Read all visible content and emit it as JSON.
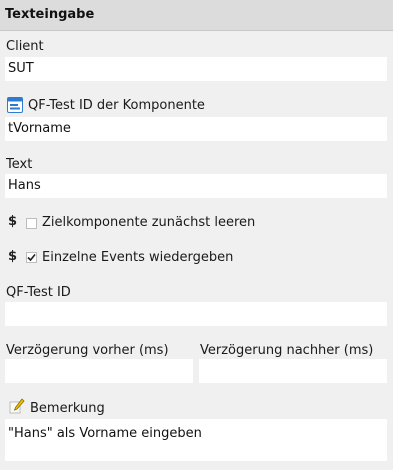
{
  "header": {
    "title": "Texteingabe"
  },
  "client": {
    "label": "Client",
    "value": "SUT"
  },
  "component_id": {
    "label": "QF-Test ID der Komponente",
    "value": "tVorname",
    "icon": "component-window-icon"
  },
  "text": {
    "label": "Text",
    "value": "Hans"
  },
  "clear_target": {
    "symbol": "$",
    "label": "Zielkomponente zunächst leeren",
    "checked": false
  },
  "single_events": {
    "symbol": "$",
    "label": "Einzelne Events wiedergeben",
    "checked": true
  },
  "qftest_id": {
    "label": "QF-Test ID",
    "value": ""
  },
  "delay_before": {
    "label": "Verzögerung vorher (ms)",
    "value": ""
  },
  "delay_after": {
    "label": "Verzögerung nachher (ms)",
    "value": ""
  },
  "comment": {
    "label": "Bemerkung",
    "value": "\"Hans\" als Vorname eingeben",
    "icon": "pencil-note-icon"
  },
  "colors": {
    "background": "#f0f0f0",
    "header": "#dcdcdc",
    "field": "#ffffff",
    "component_icon": "#2e7bcf"
  }
}
